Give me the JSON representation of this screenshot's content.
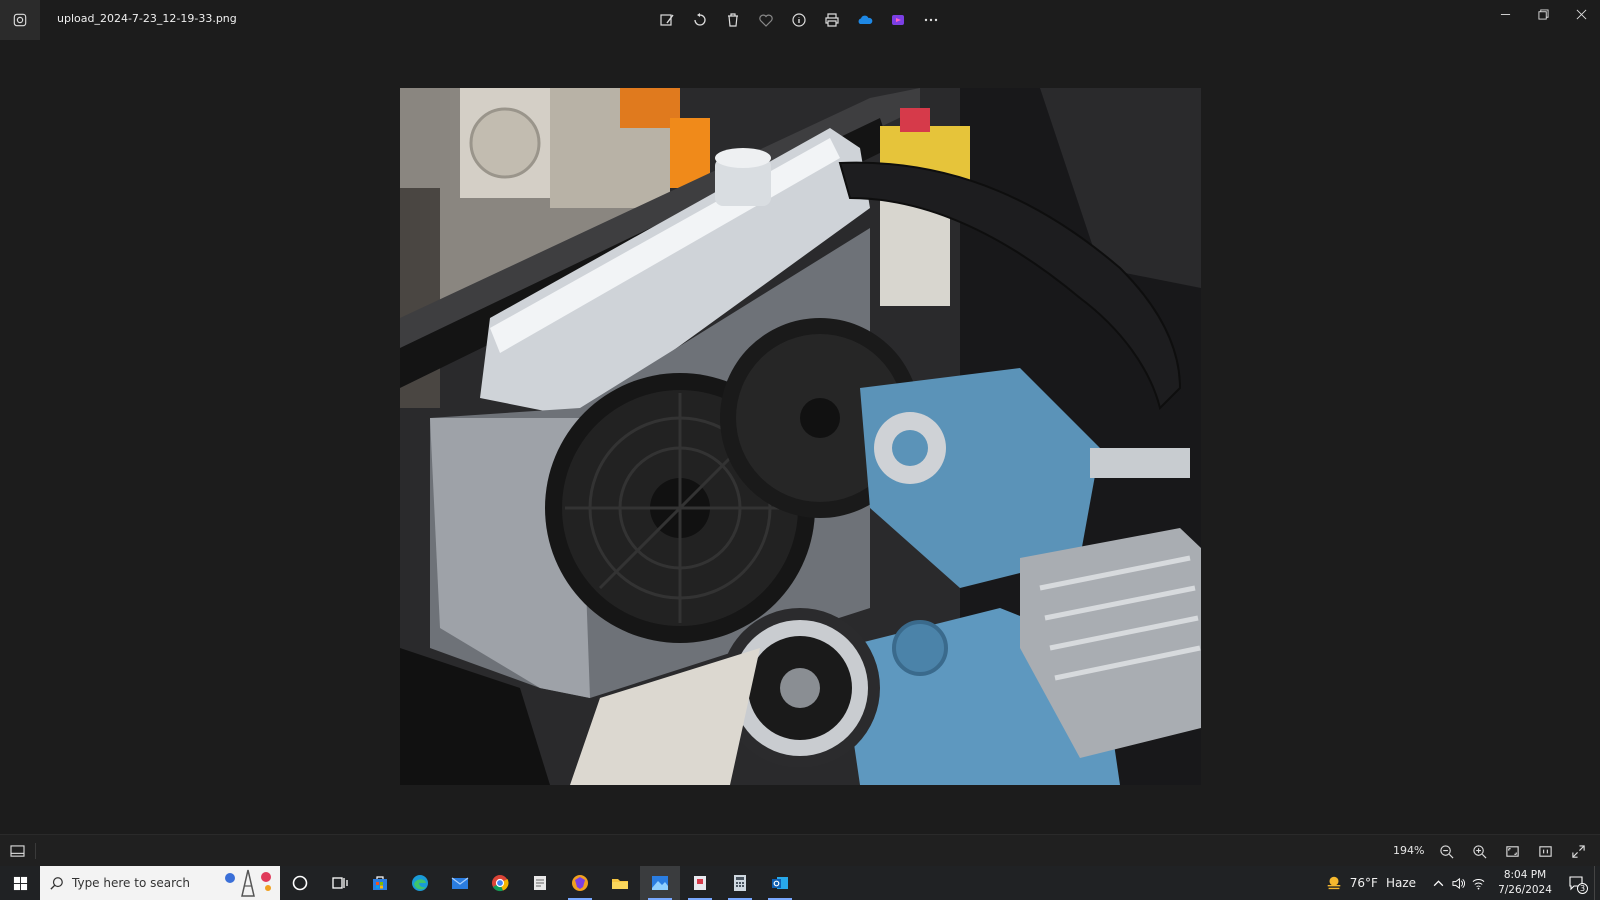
{
  "titlebar": {
    "file_name": "upload_2024-7-23_12-19-33.png",
    "toolbar": [
      {
        "name": "edit-image-icon"
      },
      {
        "name": "rotate-icon"
      },
      {
        "name": "delete-icon"
      },
      {
        "name": "favorite-heart-icon"
      },
      {
        "name": "info-icon"
      },
      {
        "name": "print-icon"
      },
      {
        "name": "onedrive-cloud-icon"
      },
      {
        "name": "clipchamp-icon"
      },
      {
        "name": "more-options-icon"
      }
    ]
  },
  "viewer": {
    "image_subject": "photo"
  },
  "statusbar": {
    "zoom_level": "194%"
  },
  "taskbar": {
    "search_placeholder": "Type here to search",
    "weather_temp": "76°F",
    "weather_condition": "Haze",
    "time": "8:04 PM",
    "date": "7/26/2024",
    "notification_count": "3"
  },
  "colors": {
    "background": "#1c1c1c",
    "taskbar": "#202224",
    "accent": "#79a9ff",
    "onedrive": "#1e88e5",
    "clipchamp": "#7b3fe4"
  }
}
